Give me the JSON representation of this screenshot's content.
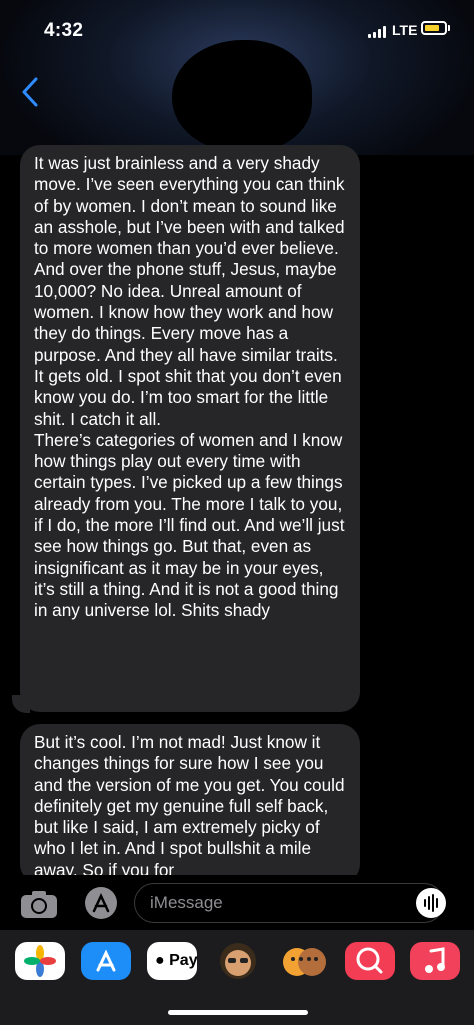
{
  "status_bar": {
    "time": "4:32",
    "network": "LTE"
  },
  "messages": [
    {
      "paragraphs": [
        "It was just brainless and a very shady move. I’ve seen everything you can think of by women. I don’t mean to sound like an asshole, but I’ve been with and talked to more women than you’d ever believe. And over the phone stuff, Jesus, maybe 10,000? No idea. Unreal amount of women. I know how they work and how they do things. Every move has a purpose. And they all have similar traits. It gets old. I spot shit that you don’t even know you do. I’m too smart for the little shit. I catch it all.",
        "There’s categories of women and I know how things play out every time with certain types. I’ve picked up a few things already from you. The more I talk to you, if I do, the more I’ll find out. And we’ll just see how things go. But that, even as insignificant as it may be in your eyes, it’s still a thing. And it is not a good thing in any universe lol. Shits shady"
      ]
    },
    {
      "paragraphs": [
        "But it’s cool. I’m not mad! Just know it changes things for sure how I see you and the version of me you get. You could definitely get my genuine full self back, but like I said, I am extremely picky of who I let in. And I spot bullshit a mile away. So if you for"
      ]
    }
  ],
  "composer": {
    "placeholder": "iMessage"
  },
  "app_tray": {
    "apple_pay_label": "Pay"
  },
  "colors": {
    "accent": "#2f8cff",
    "bubble": "#262629",
    "tray": "#1c1c1e"
  }
}
